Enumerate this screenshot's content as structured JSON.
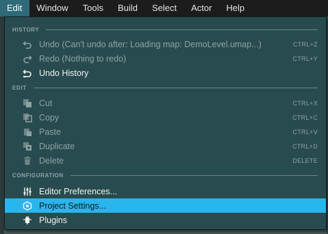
{
  "menubar": {
    "items": [
      "Edit",
      "Window",
      "Tools",
      "Build",
      "Select",
      "Actor",
      "Help"
    ]
  },
  "menu": {
    "sections": {
      "history": "HISTORY",
      "edit": "EDIT",
      "configuration": "CONFIGURATION"
    },
    "items": [
      {
        "label": "Undo (Can't undo after: Loading map: DemoLevel.umap...)",
        "shortcut": "CTRL+Z",
        "icon": "undo-icon",
        "enabled": false
      },
      {
        "label": "Redo (Nothing to redo)",
        "shortcut": "CTRL+Y",
        "icon": "redo-icon",
        "enabled": false
      },
      {
        "label": "Undo History",
        "shortcut": "",
        "icon": "undo-history-icon",
        "enabled": true
      },
      {
        "label": "Cut",
        "shortcut": "CTRL+X",
        "icon": "cut-icon",
        "enabled": false
      },
      {
        "label": "Copy",
        "shortcut": "CTRL+C",
        "icon": "copy-icon",
        "enabled": false
      },
      {
        "label": "Paste",
        "shortcut": "CTRL+V",
        "icon": "paste-icon",
        "enabled": false
      },
      {
        "label": "Duplicate",
        "shortcut": "CTRL+D",
        "icon": "duplicate-icon",
        "enabled": false
      },
      {
        "label": "Delete",
        "shortcut": "DELETE",
        "icon": "trash-icon",
        "enabled": false
      },
      {
        "label": "Editor Preferences...",
        "shortcut": "",
        "icon": "sliders-icon",
        "enabled": true
      },
      {
        "label": "Project Settings...",
        "shortcut": "",
        "icon": "project-settings-icon",
        "enabled": true,
        "highlighted": true
      },
      {
        "label": "Plugins",
        "shortcut": "",
        "icon": "plug-icon",
        "enabled": true
      }
    ]
  },
  "colors": {
    "menubar_bg": "#1c1c1c",
    "active_menu_bg": "#2e6a77",
    "dropdown_bg": "#284b4f",
    "highlight": "#29b6ec"
  }
}
